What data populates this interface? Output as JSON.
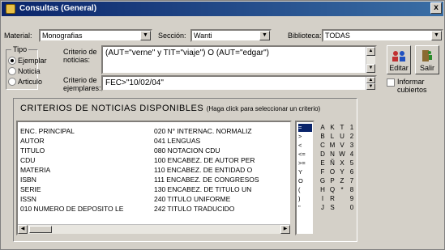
{
  "window": {
    "title": "Consultas (General)",
    "close": "x"
  },
  "filters": {
    "material_label": "Material:",
    "material_value": "Monografias",
    "seccion_label": "Sección:",
    "seccion_value": "Wanti",
    "biblioteca_label": "Biblioteca:",
    "biblioteca_value": "TODAS"
  },
  "tipo": {
    "title": "Tipo",
    "options": [
      "Ejemplar",
      "Noticia",
      "Articulo"
    ],
    "selected_index": 0
  },
  "criterio_noticias": {
    "label_line1": "Criterio de",
    "label_line2": "noticias:",
    "value": "(AUT=\"verne\" y TIT=\"viaje\") O (AUT=\"edgar\")"
  },
  "criterio_ejemplares": {
    "label_line1": "Criterio de",
    "label_line2": "ejemplares:",
    "value": "FEC>\"10/02/04\""
  },
  "buttons": {
    "editar": "Editar",
    "salir": "Salir"
  },
  "informar": {
    "line1": "Informar",
    "line2": "cubiertos"
  },
  "criterios": {
    "heading": "CRITERIOS DE NOTICIAS DISPONIBLES",
    "hint": "(Haga click para seleccionar un criterio)",
    "left": [
      "ENC. PRINCIPAL",
      "AUTOR",
      "TITULO",
      "CDU",
      "MATERIA",
      "ISBN",
      "SERIE",
      "ISSN",
      "010 NUMERO DE DEPOSITO LE"
    ],
    "right": [
      "020 N° INTERNAC. NORMALIZ",
      "041 LENGUAS",
      "080 NOTACION CDU",
      "100 ENCABEZ. DE AUTOR PER",
      "110 ENCABEZ. DE ENTIDAD O",
      "111 ENCABEZ. DE CONGRESOS",
      "130 ENCABEZ. DE TITULO UN",
      "240 TITULO UNIFORME",
      "242 TITULO TRADUCIDO"
    ],
    "operators": [
      "=",
      ">",
      "<",
      "<=",
      ">=",
      "Y",
      "O",
      "(",
      ")",
      "\""
    ],
    "char_columns": [
      [
        "A",
        "B",
        "C",
        "D",
        "E",
        "F",
        "G",
        "H",
        "I",
        "J"
      ],
      [
        "K",
        "L",
        "M",
        "N",
        "Ñ",
        "O",
        "P",
        "Q",
        "R",
        "S"
      ],
      [
        "T",
        "U",
        "V",
        "W",
        "X",
        "Y",
        "Z",
        "*",
        " ",
        " "
      ],
      [
        "1",
        "2",
        "3",
        "4",
        "5",
        "6",
        "7",
        "8",
        "9",
        "0"
      ]
    ]
  }
}
